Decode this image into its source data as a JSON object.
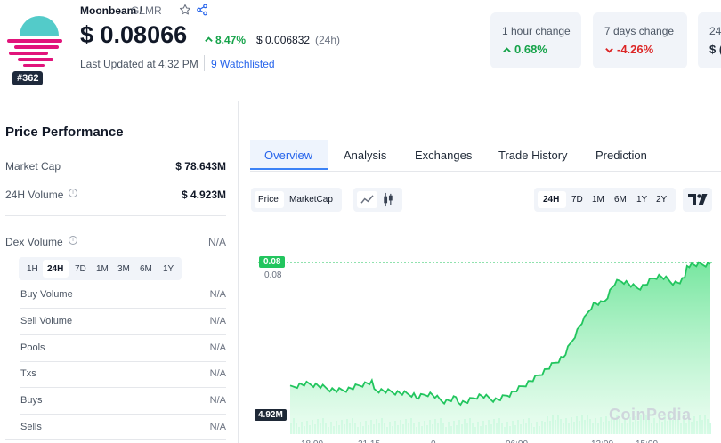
{
  "header": {
    "coin_name": "Moonbeam /",
    "coin_symbol": "GLMR",
    "rank": "#362",
    "price": "$ 0.08066",
    "change_24h": "8.47%",
    "btc_price": "$ 0.006832",
    "btc_period": "(24h)",
    "last_updated": "Last Updated at 4:32 PM",
    "watchlisted": "9 Watchlisted",
    "icons": [
      "moonbeam-logo",
      "star-icon",
      "share-icon",
      "arrow-up-icon",
      "arrow-down-icon"
    ]
  },
  "change_cards": [
    {
      "label": "1 hour change",
      "value": "0.68%",
      "direction": "up",
      "color": "#16a34a"
    },
    {
      "label": "7 days change",
      "value": "-4.26%",
      "direction": "down",
      "color": "#dc2626"
    },
    {
      "label": "24",
      "value": "$ ("
    }
  ],
  "performance": {
    "title": "Price Performance",
    "market_cap_label": "Market Cap",
    "market_cap_value": "$ 78.643M",
    "volume_label": "24H Volume",
    "volume_value": "$ 4.923M",
    "dex_volume_label": "Dex Volume",
    "dex_volume_value": "N/A",
    "dex_tabs": [
      "1H",
      "24H",
      "7D",
      "1M",
      "3M",
      "6M",
      "1Y"
    ],
    "dex_selected": "24H",
    "rows": [
      {
        "label": "Buy Volume",
        "value": "N/A"
      },
      {
        "label": "Sell Volume",
        "value": "N/A"
      },
      {
        "label": "Pools",
        "value": "N/A"
      },
      {
        "label": "Txs",
        "value": "N/A"
      },
      {
        "label": "Buys",
        "value": "N/A"
      },
      {
        "label": "Sells",
        "value": "N/A"
      }
    ]
  },
  "main_tabs": [
    "Overview",
    "Analysis",
    "Exchanges",
    "Trade History",
    "Prediction"
  ],
  "main_tab_selected": "Overview",
  "chart_controls": {
    "type_options": [
      "Price",
      "MarketCap"
    ],
    "type_selected": "Price",
    "ranges": [
      "24H",
      "7D",
      "1M",
      "6M",
      "1Y",
      "2Y"
    ],
    "range_selected": "24H",
    "chart_icons": [
      "line-chart-icon",
      "candlestick-icon",
      "tradingview-icon"
    ]
  },
  "chart": {
    "price_tag": "0.08",
    "price_axis_label": "0.08",
    "volume_tag": "4.92M",
    "watermark": "CoinPedia",
    "line_color": "#22c55e",
    "fill_color": "#bbf0cc"
  },
  "colors": {
    "up": "#16a34a",
    "down": "#dc2626",
    "accent": "#2563eb",
    "card_bg": "#f1f4f9"
  }
}
